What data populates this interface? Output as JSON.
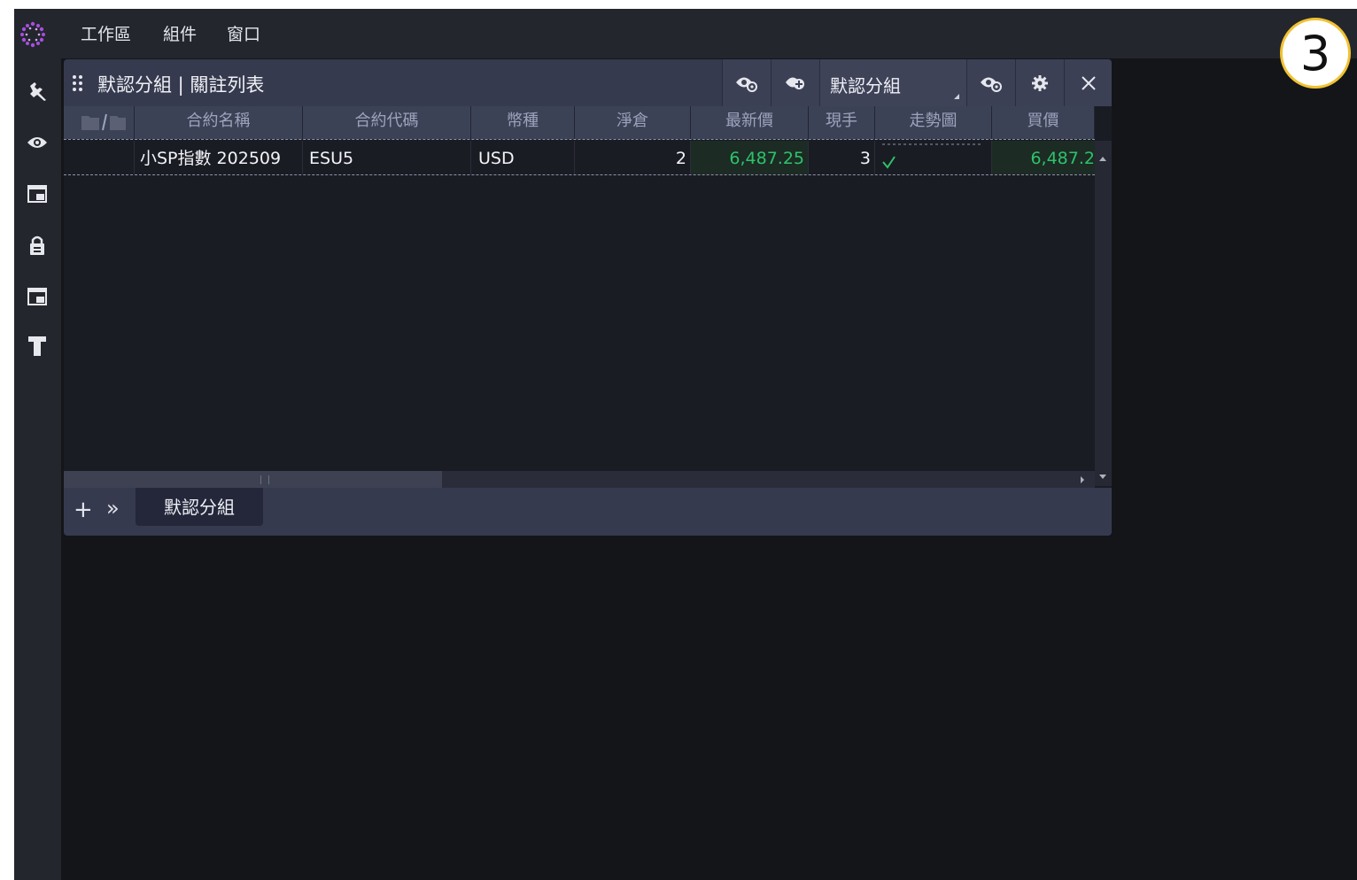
{
  "menu": {
    "workspace": "工作區",
    "components": "組件",
    "window": "窗口"
  },
  "badge": "3",
  "panel": {
    "title": "默認分組 | 關註列表",
    "group_select": "默認分組",
    "footer_tab": "默認分組",
    "add_label": "+",
    "more_label": "»"
  },
  "table": {
    "columns": {
      "folder": "",
      "name": "合約名稱",
      "code": "合約代碼",
      "currency": "幣種",
      "net_position": "淨倉",
      "last_price": "最新價",
      "volume": "現手",
      "trend": "走勢圖",
      "bid": "買價"
    },
    "rows": [
      {
        "name": "小SP指數 202509",
        "code": "ESU5",
        "currency": "USD",
        "net_position": "2",
        "last_price": "6,487.25",
        "volume": "3",
        "bid": "6,487.2"
      }
    ]
  },
  "colors": {
    "up": "#2ec26a",
    "accent": "#9b44d6",
    "badge_ring": "#f1c232"
  },
  "icons": [
    "wrench-icon",
    "eye-icon",
    "window-lock-icon",
    "lock-icon",
    "window-lock-icon",
    "text-icon",
    "grip-icon",
    "eye-settings-icon",
    "eye-add-icon",
    "gear-icon",
    "close-icon",
    "folder-icon"
  ]
}
